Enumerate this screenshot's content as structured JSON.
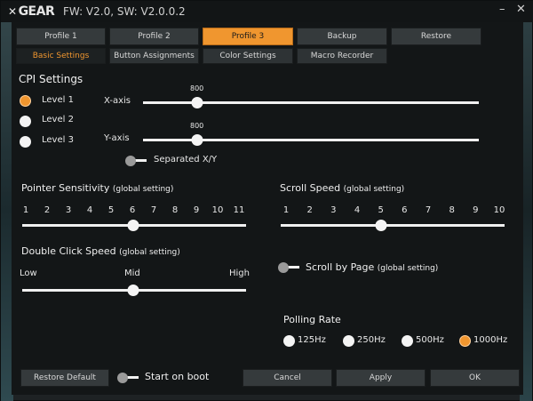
{
  "titlebar": {
    "brand": "GEAR",
    "version": "FW: V2.0, SW: V2.0.0.2",
    "minimize": "–",
    "close": "✕"
  },
  "profiles": [
    {
      "label": "Profile 1",
      "active": false
    },
    {
      "label": "Profile 2",
      "active": false
    },
    {
      "label": "Profile 3",
      "active": true
    },
    {
      "label": "Backup",
      "active": false
    },
    {
      "label": "Restore",
      "active": false
    }
  ],
  "subtabs": [
    {
      "label": "Basic Settings",
      "active": true
    },
    {
      "label": "Button Assignments",
      "active": false
    },
    {
      "label": "Color Settings",
      "active": false
    },
    {
      "label": "Macro Recorder",
      "active": false
    }
  ],
  "cpi": {
    "title": "CPI Settings",
    "levels": [
      {
        "label": "Level 1",
        "selected": true
      },
      {
        "label": "Level 2",
        "selected": false
      },
      {
        "label": "Level 3",
        "selected": false
      }
    ],
    "x_label": "X-axis",
    "x_value": "800",
    "y_label": "Y-axis",
    "y_value": "800",
    "separated_label": "Separated X/Y"
  },
  "pointer": {
    "title": "Pointer Sensitivity",
    "suffix": "(global setting)",
    "ticks": [
      "1",
      "2",
      "3",
      "4",
      "5",
      "6",
      "7",
      "8",
      "9",
      "10",
      "11"
    ],
    "value": 6
  },
  "scroll": {
    "title": "Scroll Speed",
    "suffix": "(global setting)",
    "ticks": [
      "1",
      "2",
      "3",
      "4",
      "5",
      "6",
      "7",
      "8",
      "9",
      "10"
    ],
    "value": 5
  },
  "double_click": {
    "title": "Double Click Speed",
    "suffix": "(global setting)",
    "low": "Low",
    "mid": "Mid",
    "high": "High"
  },
  "scroll_page": {
    "label": "Scroll by Page",
    "suffix": "(global setting)"
  },
  "polling": {
    "title": "Polling Rate",
    "options": [
      {
        "label": "125Hz",
        "selected": false
      },
      {
        "label": "250Hz",
        "selected": false
      },
      {
        "label": "500Hz",
        "selected": false
      },
      {
        "label": "1000Hz",
        "selected": true
      }
    ]
  },
  "footer": {
    "restore": "Restore Default",
    "boot": "Start on boot",
    "cancel": "Cancel",
    "apply": "Apply",
    "ok": "OK"
  }
}
